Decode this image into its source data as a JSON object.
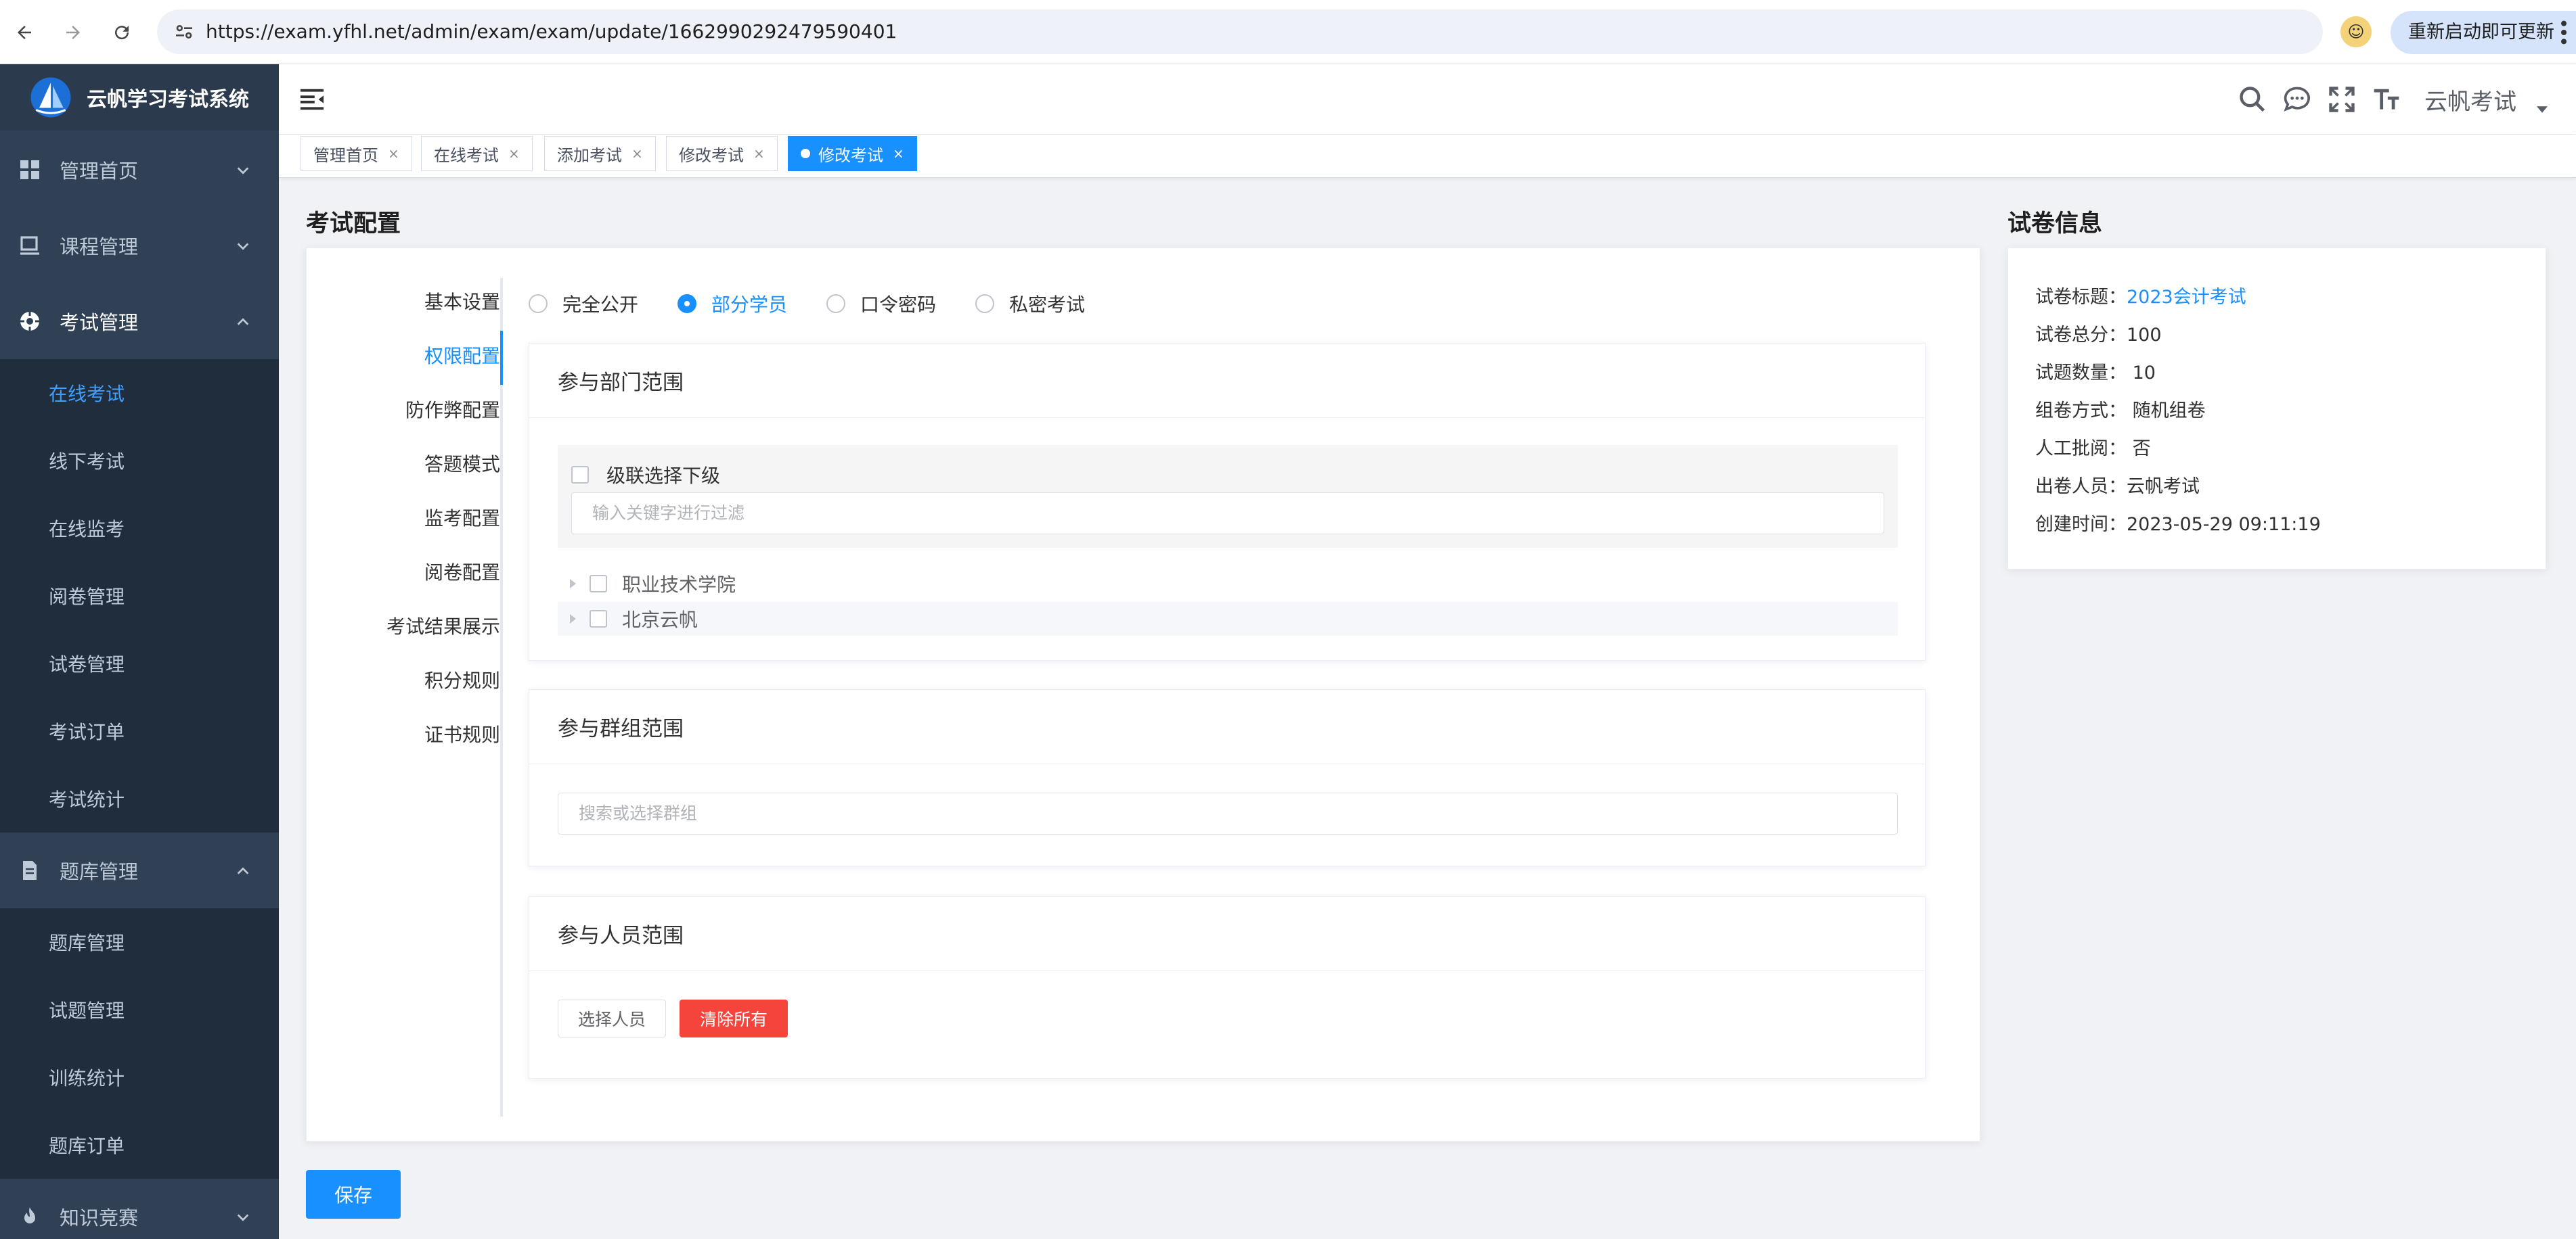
{
  "browser": {
    "url": "https://exam.yfhl.net/admin/exam/exam/update/1662990292479590401",
    "update_label": "重新启动即可更新"
  },
  "sidebar": {
    "brand": "云帆学习考试系统",
    "menus": [
      {
        "label": "管理首页",
        "icon": "dashboard-icon",
        "expanded": false
      },
      {
        "label": "课程管理",
        "icon": "course-icon",
        "expanded": false
      },
      {
        "label": "考试管理",
        "icon": "exam-icon",
        "expanded": true
      },
      {
        "label": "题库管理",
        "icon": "question-bank-icon",
        "expanded": true
      },
      {
        "label": "知识竞赛",
        "icon": "fire-icon",
        "expanded": false
      }
    ],
    "exam_sub": [
      "在线考试",
      "线下考试",
      "在线监考",
      "阅卷管理",
      "试卷管理",
      "考试订单",
      "考试统计"
    ],
    "bank_sub": [
      "题库管理",
      "试题管理",
      "训练统计",
      "题库订单"
    ],
    "active_sub": "在线考试"
  },
  "header": {
    "user": "云帆考试"
  },
  "tags": [
    {
      "label": "管理首页",
      "active": false
    },
    {
      "label": "在线考试",
      "active": false
    },
    {
      "label": "添加考试",
      "active": false
    },
    {
      "label": "修改考试",
      "active": false
    },
    {
      "label": "修改考试",
      "active": true
    }
  ],
  "config": {
    "title": "考试配置",
    "tabs": [
      "基本设置",
      "权限配置",
      "防作弊配置",
      "答题模式",
      "监考配置",
      "阅卷配置",
      "考试结果展示",
      "积分规则",
      "证书规则"
    ],
    "active_tab": "权限配置",
    "access_options": [
      "完全公开",
      "部分学员",
      "口令密码",
      "私密考试"
    ],
    "selected_access": "部分学员",
    "dept_panel": {
      "title": "参与部门范围",
      "cascade_label": "级联选择下级",
      "filter_placeholder": "输入关键字进行过滤",
      "nodes": [
        "职业技术学院",
        "北京云帆"
      ]
    },
    "group_panel": {
      "title": "参与群组范围",
      "placeholder": "搜索或选择群组"
    },
    "user_panel": {
      "title": "参与人员范围",
      "select_label": "选择人员",
      "clear_label": "清除所有"
    },
    "save_label": "保存"
  },
  "paper": {
    "title": "试卷信息",
    "rows": [
      {
        "label": "试卷标题：",
        "value": "2023会计考试",
        "link": true
      },
      {
        "label": "试卷总分：",
        "value": "100"
      },
      {
        "label": "试题数量：",
        "value": " 10"
      },
      {
        "label": "组卷方式：",
        "value": " 随机组卷"
      },
      {
        "label": "人工批阅：",
        "value": " 否"
      },
      {
        "label": "出卷人员：",
        "value": "云帆考试"
      },
      {
        "label": "创建时间：",
        "value": "2023-05-29 09:11:19"
      }
    ]
  },
  "colors": {
    "primary": "#1890ff",
    "danger": "#f5443b",
    "sidebar_bg": "#304156",
    "sidebar_sub_bg": "#1f2d3d"
  }
}
